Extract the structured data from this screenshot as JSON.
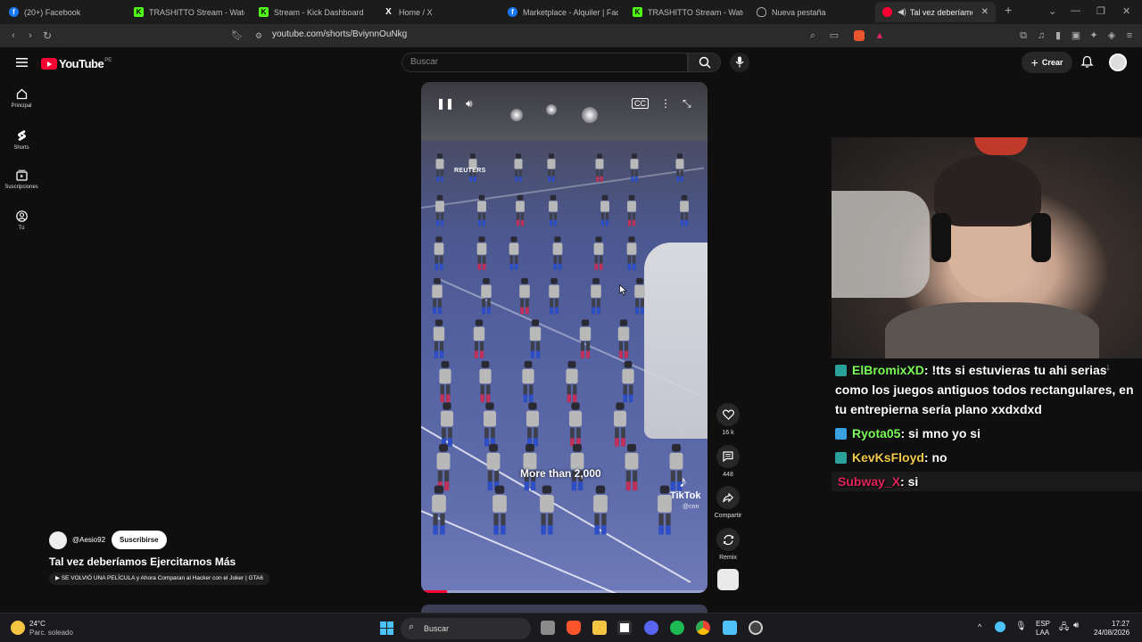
{
  "browser": {
    "tabs": [
      {
        "label": "(20+) Facebook",
        "favicon": "facebook-icon",
        "color": "#1877f2",
        "active": false
      },
      {
        "label": "TRASHITTO Stream - Watch Li",
        "favicon": "kick-icon",
        "color": "#53fc18",
        "active": false
      },
      {
        "label": "Stream - Kick Dashboard",
        "favicon": "kick-icon",
        "color": "#53fc18",
        "active": false
      },
      {
        "label": "Home / X",
        "favicon": "x-icon",
        "color": "#ffffff",
        "active": false
      },
      {
        "label": "Marketplace - Alquiler | Faceb",
        "favicon": "facebook-icon",
        "color": "#1877f2",
        "active": false
      },
      {
        "label": "TRASHITTO Stream - Watch Li",
        "favicon": "kick-icon",
        "color": "#53fc18",
        "active": false
      },
      {
        "label": "Nueva pestaña",
        "favicon": "brave-shield-icon",
        "color": "#aaaaaa",
        "active": false
      },
      {
        "label": "Tal vez deberíamos Eje",
        "favicon": "youtube-icon",
        "color": "#ff0033",
        "active": true
      }
    ],
    "url": "youtube.com/shorts/BviynnOuNkg"
  },
  "youtube": {
    "logo_text": "YouTube",
    "country_code": "PE",
    "search_placeholder": "Buscar",
    "create_label": "Crear",
    "nav": [
      {
        "label": "Principal",
        "icon": "home-icon"
      },
      {
        "label": "Shorts",
        "icon": "shorts-icon"
      },
      {
        "label": "Suscripciones",
        "icon": "subscriptions-icon"
      },
      {
        "label": "Tú",
        "icon": "you-icon"
      }
    ],
    "video": {
      "watermark": "REUTERS",
      "caption": "More than 2,000",
      "tiktok": "TikTok",
      "tiktok_handle": "@cnn",
      "progress": 0.09
    },
    "actions": {
      "likes": "16 k",
      "comments": "448",
      "share": "Compartir",
      "remix": "Remix"
    },
    "channel": "@Aesio92",
    "subscribe_label": "Suscribirse",
    "title": "Tal vez deberíamos Ejercitarnos Más",
    "related": "SE VOLVIÓ UNA PELÍCULA y Ahora Comparan al Hacker con el Joker | GTA6"
  },
  "chat": [
    {
      "user": "ElBromixXD",
      "color": "#7CFC5A",
      "badge": "#2aa198",
      "text": ": !tts si estuvieras tu ahi serias como los juegos antiguos todos rectangulares, en tu entrepierna sería plano xxdxdxd"
    },
    {
      "user": "Ryota05",
      "color": "#7CFC5A",
      "badge": "#3aa0e0",
      "text": ": si mno yo si"
    },
    {
      "user": "KevKsFloyd",
      "color": "#f2c94c",
      "badge": "#2aa198",
      "text": ": no"
    },
    {
      "user": "Subway_X",
      "color": "#e0245e",
      "badge": "",
      "text": ": si"
    }
  ],
  "taskbar": {
    "weather_temp": "24°C",
    "weather_desc": "Parc. soleado",
    "search_label": "Buscar",
    "lang_top": "ESP",
    "lang_bottom": "LAA",
    "time": "17:27",
    "date": "24/08/2026"
  }
}
